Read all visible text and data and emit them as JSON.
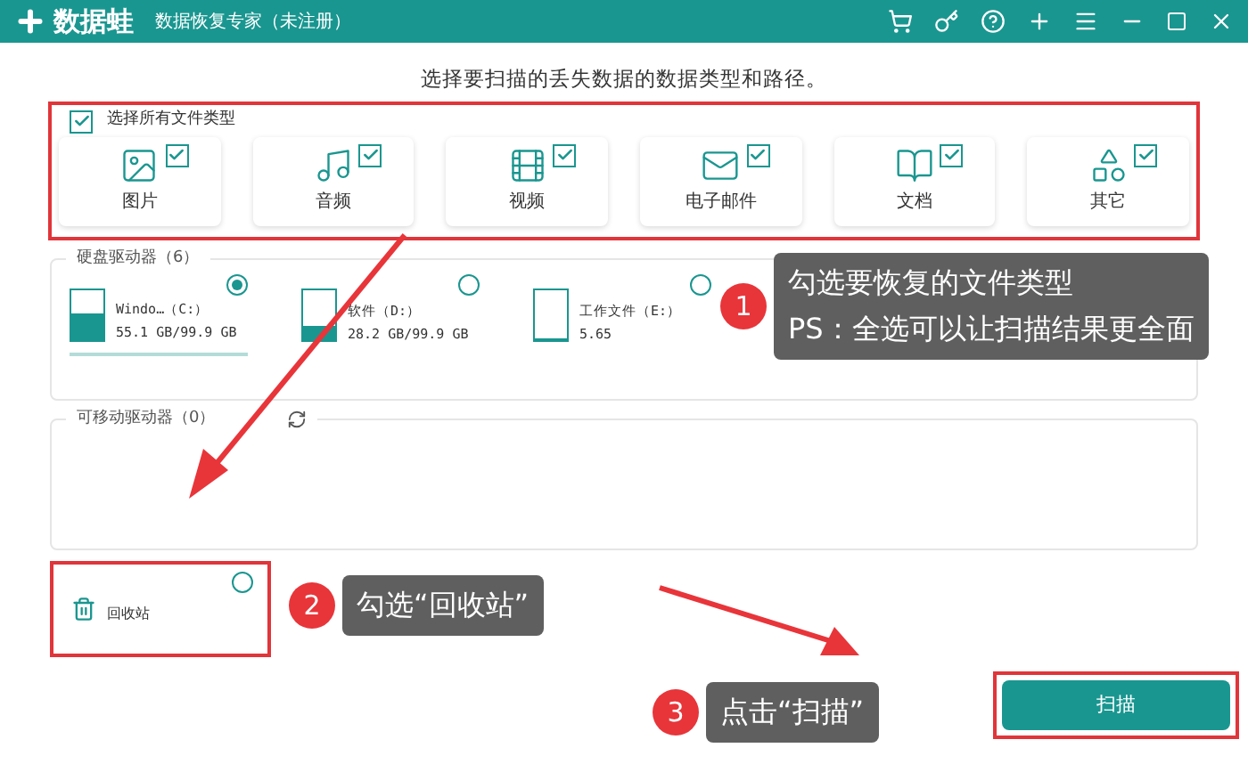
{
  "window": {
    "logo": "数据蛙",
    "title": "数据恢复专家（未注册）"
  },
  "heading": "选择要扫描的丢失数据的数据类型和路径。",
  "file_types": {
    "select_all": {
      "label": "选择所有文件类型",
      "checked": true
    },
    "items": [
      {
        "kind": "image",
        "label": "图片",
        "checked": true
      },
      {
        "kind": "audio",
        "label": "音频",
        "checked": true
      },
      {
        "kind": "video",
        "label": "视频",
        "checked": true
      },
      {
        "kind": "email",
        "label": "电子邮件",
        "checked": true
      },
      {
        "kind": "document",
        "label": "文档",
        "checked": true
      },
      {
        "kind": "other",
        "label": "其它",
        "checked": true
      }
    ]
  },
  "hard_drives": {
    "title": "硬盘驱动器（6）",
    "items": [
      {
        "name": "Windo…（C:）",
        "size": "55.1 GB/99.9 GB",
        "level": 0.55,
        "selected": true
      },
      {
        "name": "软件（D:）",
        "size": "28.2 GB/99.9 GB",
        "level": 0.3,
        "selected": false
      },
      {
        "name": "工作文件（E:）",
        "size": "5.65",
        "level": 0.05,
        "selected": false
      }
    ]
  },
  "removable_drives": {
    "title": "可移动驱动器（0）"
  },
  "recycle_bin": {
    "label": "回收站",
    "selected": false
  },
  "scan_button": "扫描",
  "callouts": [
    {
      "number": "1",
      "lines": [
        "勾选要恢复的文件类型",
        "PS：全选可以让扫描结果更全面"
      ]
    },
    {
      "number": "2",
      "lines": [
        "勾选“回收站”"
      ]
    },
    {
      "number": "3",
      "lines": [
        "点击“扫描”"
      ]
    }
  ]
}
